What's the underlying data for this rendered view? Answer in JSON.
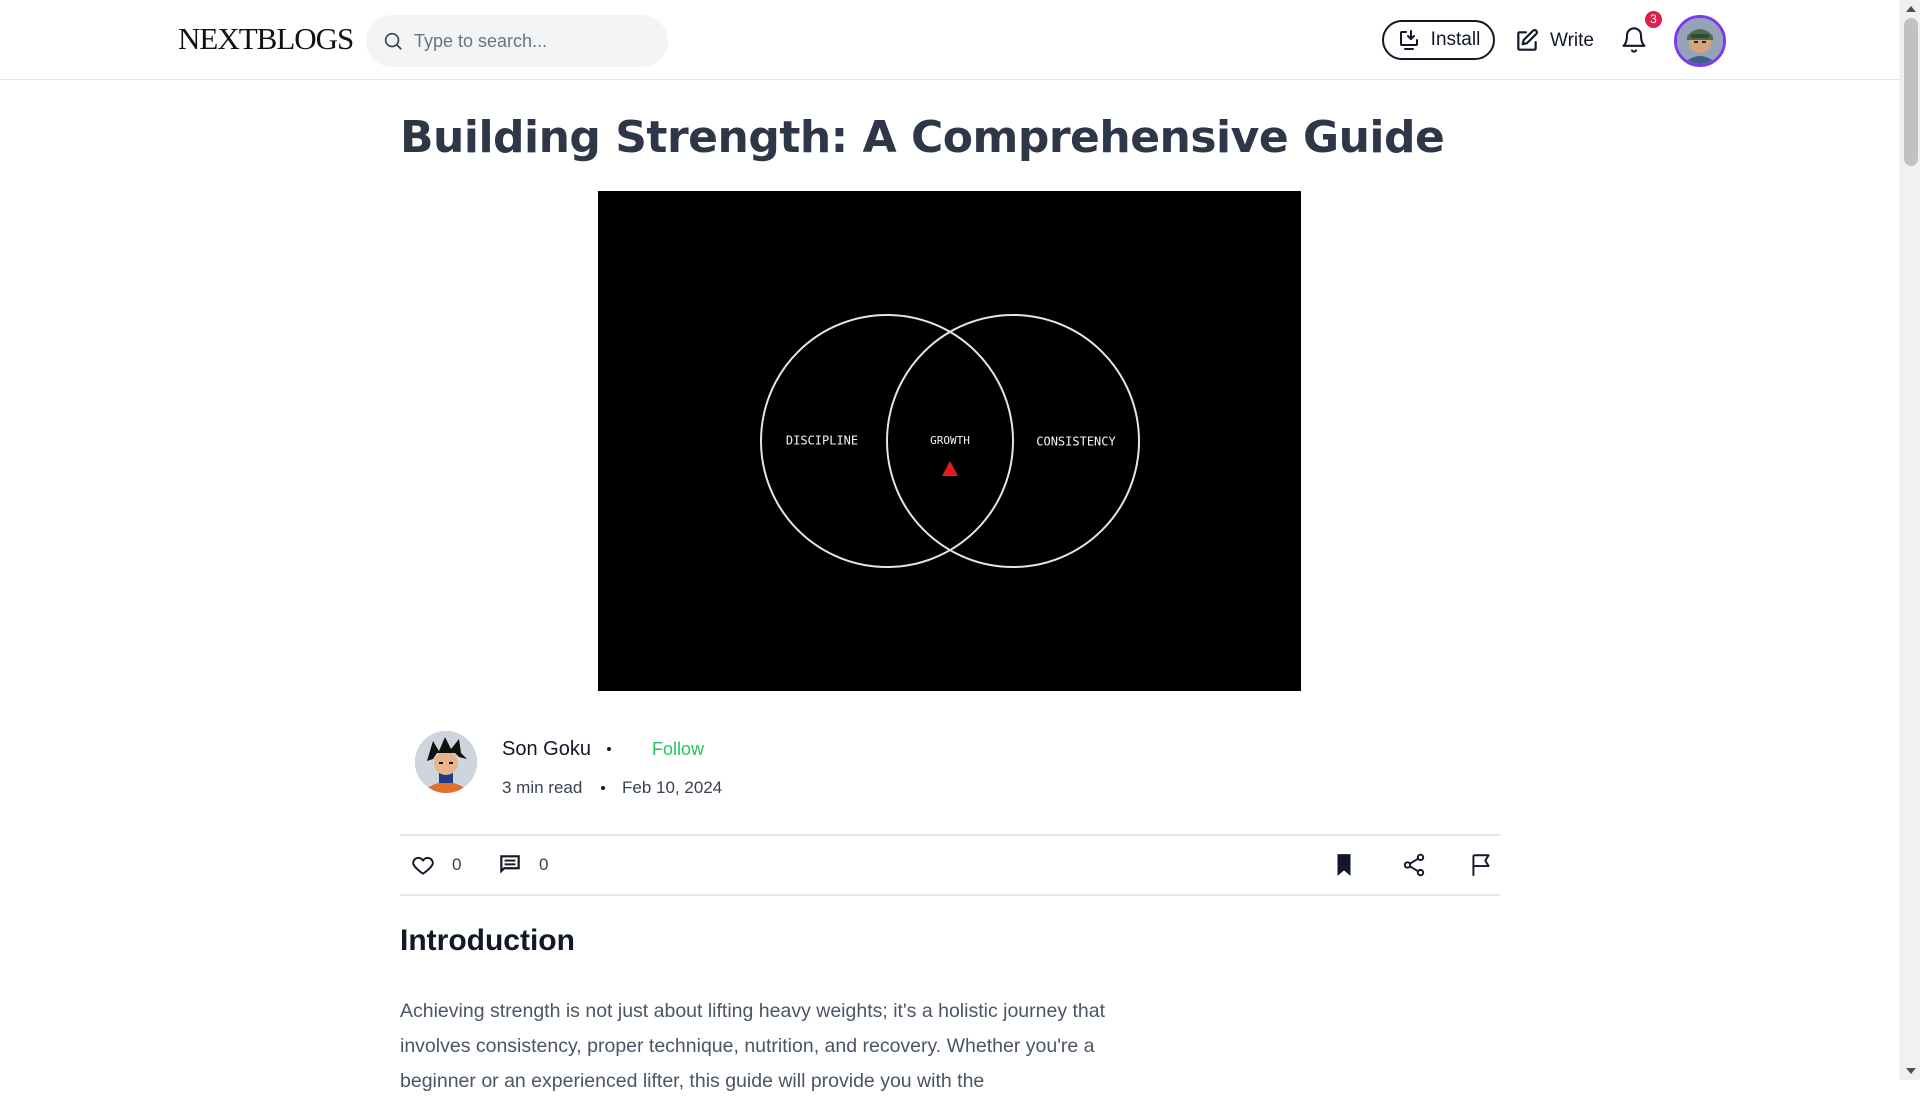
{
  "header": {
    "logo": "NEXTBLOGS",
    "search_placeholder": "Type to search...",
    "install_label": "Install",
    "write_label": "Write",
    "notification_count": "3"
  },
  "article": {
    "title": "Building Strength: A Comprehensive Guide",
    "cover": {
      "labels": [
        "DISCIPLINE",
        "GROWTH",
        "CONSISTENCY"
      ],
      "accent_color": "#e11d1d"
    },
    "author": {
      "name": "Son Goku",
      "follow_label": "Follow",
      "read_time": "3 min read",
      "date": "Feb 10, 2024"
    },
    "stats": {
      "likes": "0",
      "comments": "0"
    },
    "section_heading": "Introduction",
    "body": "Achieving strength is not just about lifting heavy weights; it's a holistic journey that involves consistency, proper technique, nutrition, and recovery. Whether you're a beginner or an experienced lifter, this guide will provide you with the"
  },
  "colors": {
    "follow": "#22c55e",
    "badge": "#e11d48",
    "avatar_ring": "#7c3aed"
  }
}
